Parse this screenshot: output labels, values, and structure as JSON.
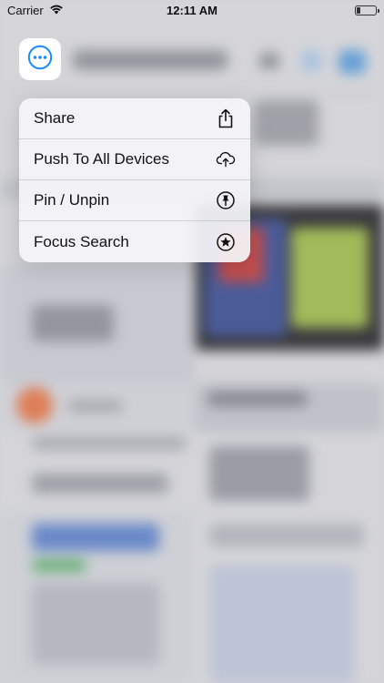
{
  "status_bar": {
    "carrier": "Carrier",
    "time": "12:11 AM"
  },
  "more_button": {
    "icon": "ellipsis-circle-icon",
    "color": "#1a8cff"
  },
  "menu": {
    "items": [
      {
        "label": "Share",
        "icon": "share-icon"
      },
      {
        "label": "Push To All Devices",
        "icon": "cloud-upload-icon"
      },
      {
        "label": "Pin / Unpin",
        "icon": "pin-icon"
      },
      {
        "label": "Focus Search",
        "icon": "star-circle-icon"
      }
    ]
  },
  "colors": {
    "accent": "#1a8cff",
    "menu_bg": "#f5f5f7",
    "text": "#111111"
  }
}
